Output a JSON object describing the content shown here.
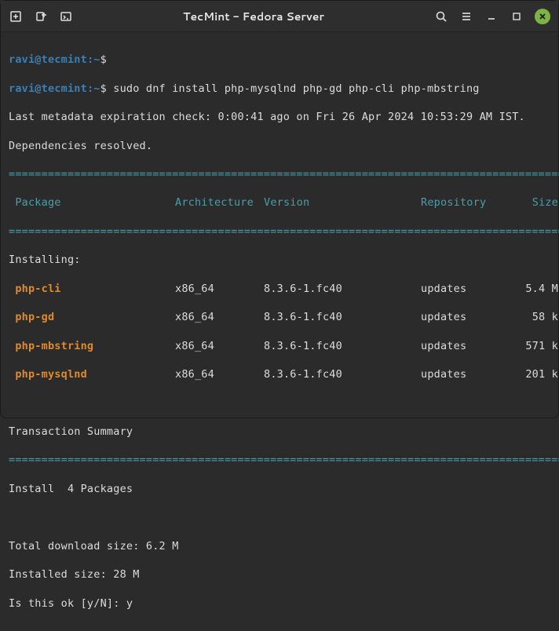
{
  "titlebar": {
    "title": "TecMint - Fedora Server"
  },
  "prompt": {
    "user_host": "ravi@tecmint",
    "path": "~",
    "symbol": "$"
  },
  "command": "sudo dnf install php-mysqlnd php-gd php-cli php-mbstring",
  "metadata_line": "Last metadata expiration check: 0:00:41 ago on Fri 26 Apr 2024 10:53:29 AM IST.",
  "deps_line": "Dependencies resolved.",
  "headers": {
    "package": "Package",
    "arch": "Architecture",
    "version": "Version",
    "repo": "Repository",
    "size": "Size"
  },
  "installing_label": "Installing:",
  "packages": [
    {
      "name": "php-cli",
      "arch": "x86_64",
      "version": "8.3.6-1.fc40",
      "repo": "updates",
      "size": "5.4 M"
    },
    {
      "name": "php-gd",
      "arch": "x86_64",
      "version": "8.3.6-1.fc40",
      "repo": "updates",
      "size": "58 k"
    },
    {
      "name": "php-mbstring",
      "arch": "x86_64",
      "version": "8.3.6-1.fc40",
      "repo": "updates",
      "size": "571 k"
    },
    {
      "name": "php-mysqlnd",
      "arch": "x86_64",
      "version": "8.3.6-1.fc40",
      "repo": "updates",
      "size": "201 k"
    }
  ],
  "summary_label": "Transaction Summary",
  "install_count": "Install  4 Packages",
  "download_size": "Total download size: 6.2 M",
  "installed_size": "Installed size: 28 M",
  "confirm_prompt": "Is this ok [y/N]: ",
  "confirm_answer": "y",
  "divider": "=========================================================================================="
}
